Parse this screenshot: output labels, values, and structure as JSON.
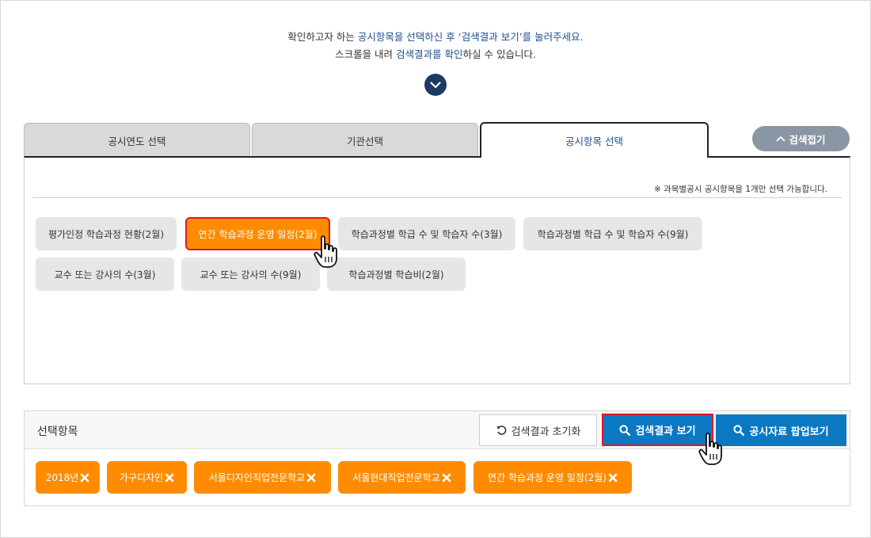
{
  "intro": {
    "line1_pre": "확인하고자 하는 ",
    "line1_hl": "공시항목을 선택하신 후 ‘검색결과 보기’를 눌러주세요.",
    "line2_pre": "스크롤을 내려 ",
    "line2_hl": "검색결과를 확인",
    "line2_post": "하실 수 있습니다."
  },
  "tabs": [
    {
      "label": "공시연도 선택"
    },
    {
      "label": "기관선택"
    },
    {
      "label": "공시항목 선택"
    }
  ],
  "collapse_button": {
    "label": "검색접기"
  },
  "notice": "※ 과목별공시 공시항목을 1개만 선택 가능합니다.",
  "items": [
    {
      "label": "평가인정 학습과정 현황(2월)"
    },
    {
      "label": "연간 학습과정 운영 일정(2월)"
    },
    {
      "label": "학습과정별 학급 수 및 학습자 수(3월)"
    },
    {
      "label": "학습과정별 학급 수 및 학습자 수(9월)"
    },
    {
      "label": "교수 또는 강사의 수(3월)"
    },
    {
      "label": "교수 또는 강사의 수(9월)"
    },
    {
      "label": "학습과정별 학습비(2월)"
    }
  ],
  "selected": {
    "title": "선택항목",
    "reset_label": "검색결과 초기화",
    "search_label": "검색결과 보기",
    "popup_label": "공시자료 팝업보기",
    "chips": [
      {
        "label": "2018년"
      },
      {
        "label": "가구디자인"
      },
      {
        "label": "서울디자인직업전문학교"
      },
      {
        "label": "서울현대직업전문학교"
      },
      {
        "label": "연간 학습과정 운영 일정(2월)"
      }
    ]
  },
  "colors": {
    "accent_orange": "#ff8c00",
    "primary_blue": "#0a78c2",
    "highlight_red": "#e0162b",
    "navy": "#1c3a63"
  },
  "icons": [
    "chevron-down-icon",
    "chevron-up-icon",
    "reset-icon",
    "search-icon",
    "close-icon",
    "hand-pointer-icon"
  ]
}
